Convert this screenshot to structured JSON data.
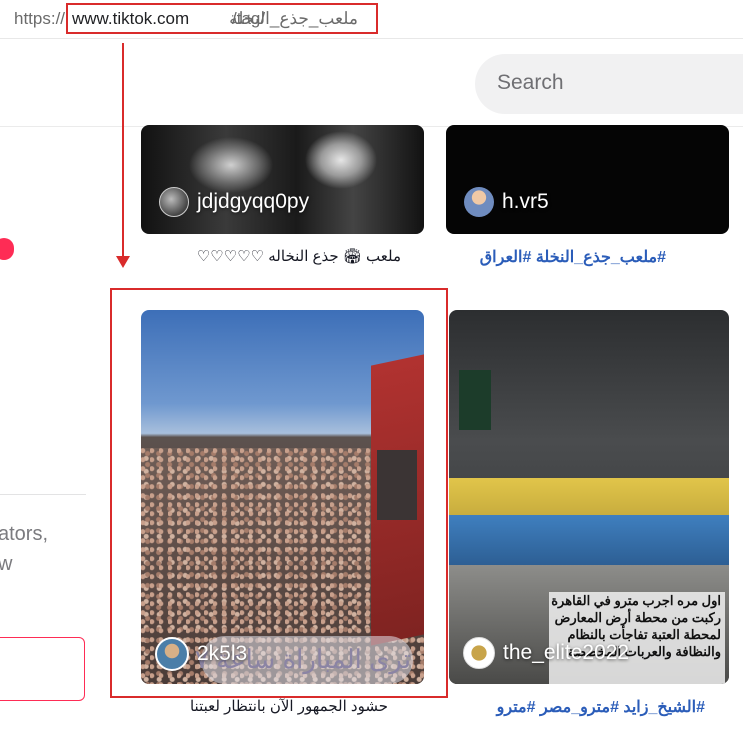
{
  "url_bar": {
    "scheme": "https://",
    "host": "www.tiktok.com",
    "path": "/tag/",
    "tag": "ملعب_جذع_النخلة"
  },
  "header": {
    "search_placeholder": "Search"
  },
  "sidebar": {
    "partial_line1": "ators,",
    "partial_line2": "w"
  },
  "videos": [
    {
      "author": "jdjdgyqq0py",
      "caption": "ملعب 🏟 جذع النخاله ♡♡♡♡♡"
    },
    {
      "author": "h.vr5",
      "caption": "#ملعب_جذع_النخلة #العراق"
    },
    {
      "author": "2k5l3",
      "overlay_text": "ترى المباراة ساعة ٧",
      "caption": "حشود الجمهور الآن بانتظار لعبتنا"
    },
    {
      "author": "the_elite2022",
      "overlay_text": "اول مره اجرب مترو في القاهرة ركبت من محطة أرض المعارض لمحطة العتبة تفاجأت بالنظام والنظافة والعربات المخصصة",
      "caption": "#الشيخ_زايد #مترو_مصر #مترو"
    }
  ],
  "colors": {
    "annotation_red": "#d92b2b",
    "hashtag_blue": "#2b5db9",
    "tiktok_pink": "#fe2c55"
  }
}
